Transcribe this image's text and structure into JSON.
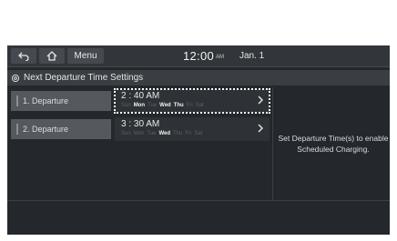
{
  "topbar": {
    "back_icon": "back-arrow-icon",
    "home_icon": "home-icon",
    "menu_label": "Menu",
    "time": "12:00",
    "ampm": "AM",
    "date": "Jan. 1"
  },
  "title": {
    "icon": "gear-icon",
    "text": "Next Departure Time Settings"
  },
  "departures": [
    {
      "label": "1. Departure",
      "time": "2 : 40 AM",
      "days": [
        {
          "name": "Sun",
          "active": false
        },
        {
          "name": "Mon",
          "active": true
        },
        {
          "name": "Tue",
          "active": false
        },
        {
          "name": "Wed",
          "active": true
        },
        {
          "name": "Thu",
          "active": true
        },
        {
          "name": "Fri",
          "active": false
        },
        {
          "name": "Sat",
          "active": false
        }
      ]
    },
    {
      "label": "2. Departure",
      "time": "3 : 30 AM",
      "days": [
        {
          "name": "Sun",
          "active": false
        },
        {
          "name": "Mon",
          "active": false
        },
        {
          "name": "Tue",
          "active": false
        },
        {
          "name": "Wed",
          "active": true
        },
        {
          "name": "Thu",
          "active": false
        },
        {
          "name": "Fri",
          "active": false
        },
        {
          "name": "Sat",
          "active": false
        }
      ]
    }
  ],
  "note": "Set Departure Time(s) to enable Scheduled Charging.",
  "colors": {
    "screen_bg": "#24272b",
    "row_label_bg": "#55595e",
    "focus_outline": "#ffffff"
  }
}
